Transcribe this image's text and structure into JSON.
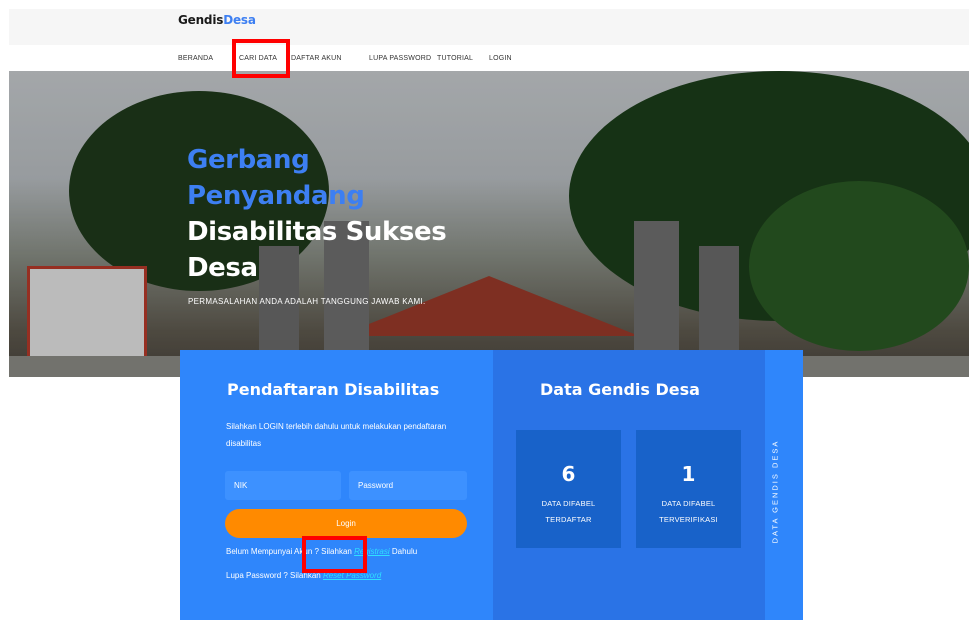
{
  "brand": {
    "part1": "Gendis",
    "part2": "Desa"
  },
  "nav": {
    "items": [
      "BERANDA",
      "CARI DATA",
      "DAFTAR AKUN",
      "LUPA PASSWORD",
      "TUTORIAL",
      "LOGIN"
    ]
  },
  "hero": {
    "title_blue_1": "Gerbang",
    "title_blue_2": "Penyandang",
    "title_white_1": "Disabilitas Sukses",
    "title_white_2": "Desa",
    "subtitle": "PERMASALAHAN ANDA ADALAH TANGGUNG JAWAB KAMI."
  },
  "registration": {
    "title": "Pendaftaran Disabilitas",
    "description": "Silahkan LOGIN terlebih dahulu untuk melakukan pendaftaran disabilitas",
    "nik_placeholder": "NIK",
    "password_placeholder": "Password",
    "login_button": "Login",
    "no_account_prefix": "Belum Mempunyai Akun ? Silahkan ",
    "register_link": "Registrasi",
    "no_account_suffix": " Dahulu",
    "forgot_prefix": "Lupa Password ? Silahkan ",
    "reset_link": "Reset Password"
  },
  "data_panel": {
    "title": "Data Gendis Desa",
    "stats": [
      {
        "value": "6",
        "label": "DATA DIFABEL TERDAFTAR"
      },
      {
        "value": "1",
        "label": "DATA DIFABEL TERVERIFIKASI"
      }
    ],
    "vertical_label": "DATA GENDIS DESA"
  },
  "colors": {
    "accent_blue": "#3d7ff2",
    "panel_blue": "#2f86fb",
    "orange": "#ff8a00",
    "highlight_red": "#ff0000"
  }
}
